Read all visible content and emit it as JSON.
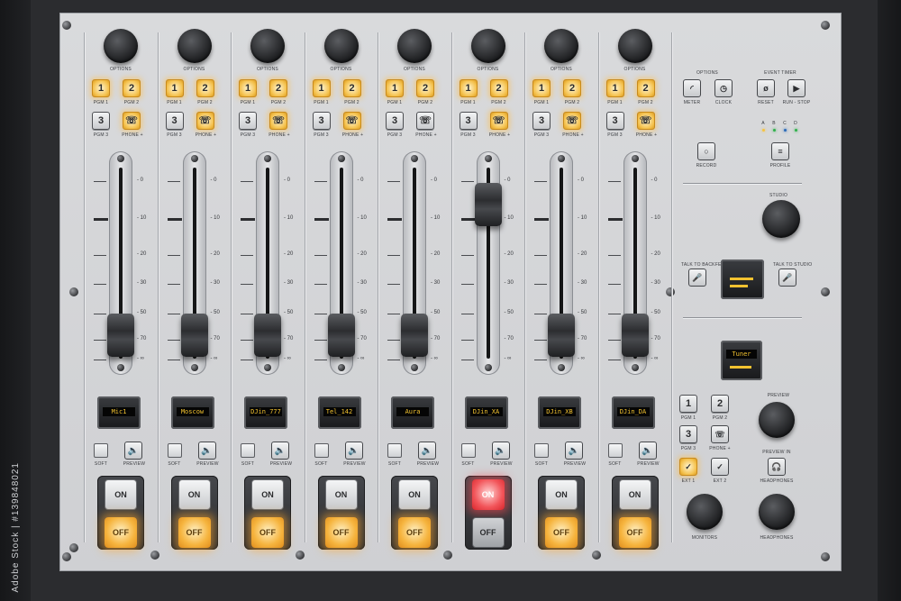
{
  "channels": [
    {
      "knob_label": "OPTIONS",
      "pgm1": "1",
      "pgm2": "2",
      "pgm3": "3",
      "pgm1_label": "PGM 1",
      "pgm2_label": "PGM 2",
      "pgm3_label": "PGM 3",
      "phone_label": "PHONE +",
      "display": "Mic1",
      "soft_label": "SOFT",
      "preview_label": "PREVIEW",
      "on_label": "ON",
      "off_label": "OFF",
      "fader_level": 0.12
    },
    {
      "knob_label": "OPTIONS",
      "pgm1": "1",
      "pgm2": "2",
      "pgm3": "3",
      "pgm1_label": "PGM 1",
      "pgm2_label": "PGM 2",
      "pgm3_label": "PGM 3",
      "phone_label": "PHONE +",
      "display": "Moscow",
      "soft_label": "SOFT",
      "preview_label": "PREVIEW",
      "on_label": "ON",
      "off_label": "OFF",
      "fader_level": 0.12
    },
    {
      "knob_label": "OPTIONS",
      "pgm1": "1",
      "pgm2": "2",
      "pgm3": "3",
      "pgm1_label": "PGM 1",
      "pgm2_label": "PGM 2",
      "pgm3_label": "PGM 3",
      "phone_label": "PHONE +",
      "display": "DJin_777",
      "soft_label": "SOFT",
      "preview_label": "PREVIEW",
      "on_label": "ON",
      "off_label": "OFF",
      "fader_level": 0.12
    },
    {
      "knob_label": "OPTIONS",
      "pgm1": "1",
      "pgm2": "2",
      "pgm3": "3",
      "pgm1_label": "PGM 1",
      "pgm2_label": "PGM 2",
      "pgm3_label": "PGM 3",
      "phone_label": "PHONE +",
      "display": "Tel_142",
      "soft_label": "SOFT",
      "preview_label": "PREVIEW",
      "on_label": "ON",
      "off_label": "OFF",
      "fader_level": 0.12
    },
    {
      "knob_label": "OPTIONS",
      "pgm1": "1",
      "pgm2": "2",
      "pgm3": "3",
      "pgm1_label": "PGM 1",
      "pgm2_label": "PGM 2",
      "pgm3_label": "PGM 3",
      "phone_label": "PHONE +",
      "display": "Aura",
      "soft_label": "SOFT",
      "preview_label": "PREVIEW",
      "on_label": "ON",
      "off_label": "OFF",
      "fader_level": 0.12
    },
    {
      "knob_label": "OPTIONS",
      "pgm1": "1",
      "pgm2": "2",
      "pgm3": "3",
      "pgm1_label": "PGM 1",
      "pgm2_label": "PGM 2",
      "pgm3_label": "PGM 3",
      "phone_label": "PHONE +",
      "display": "DJin_XA",
      "soft_label": "SOFT",
      "preview_label": "PREVIEW",
      "on_label": "ON",
      "off_label": "OFF",
      "fader_level": 0.86
    },
    {
      "knob_label": "OPTIONS",
      "pgm1": "1",
      "pgm2": "2",
      "pgm3": "3",
      "pgm1_label": "PGM 1",
      "pgm2_label": "PGM 2",
      "pgm3_label": "PGM 3",
      "phone_label": "PHONE +",
      "display": "DJin_XB",
      "soft_label": "SOFT",
      "preview_label": "PREVIEW",
      "on_label": "ON",
      "off_label": "OFF",
      "fader_level": 0.12
    },
    {
      "knob_label": "OPTIONS",
      "pgm1": "1",
      "pgm2": "2",
      "pgm3": "3",
      "pgm1_label": "PGM 1",
      "pgm2_label": "PGM 2",
      "pgm3_label": "PGM 3",
      "phone_label": "PHONE +",
      "display": "DJin_DA",
      "soft_label": "SOFT",
      "preview_label": "PREVIEW",
      "on_label": "ON",
      "off_label": "OFF",
      "fader_level": 0.12
    }
  ],
  "fader_scale": [
    "- 0",
    "- 10",
    "- 20",
    "- 30",
    "- 50",
    "- 70",
    "- ∞"
  ],
  "master": {
    "options_title": "OPTIONS",
    "event_timer_title": "EVENT TIMER",
    "meter_label": "METER",
    "clock_label": "CLOCK",
    "reset_label": "RESET",
    "run_stop_label": "RUN - STOP",
    "leds": [
      "A",
      "B",
      "C",
      "D"
    ],
    "record_label": "RECORD",
    "profile_label": "PROFILE",
    "studio_label": "STUDIO",
    "talk_backfeeds_label": "TALK TO BACKFEEDS",
    "talk_studio_label": "TALK TO STUDIO",
    "tuner_display": "Tuner",
    "pgm1": "1",
    "pgm2": "2",
    "pgm3": "3",
    "pgm1_label": "PGM 1",
    "pgm2_label": "PGM 2",
    "pgm3_label": "PGM 3",
    "phone_label": "PHONE +",
    "ext1_label": "EXT 1",
    "ext2_label": "EXT 2",
    "preview_title": "PREVIEW",
    "preview_in_label": "PREVIEW IN",
    "headphones_btn_label": "HEADPHONES",
    "monitors_label": "MONITORS",
    "headphones_label": "HEADPHONES"
  },
  "watermark": "Adobe Stock | #139848021",
  "colors": {
    "amber": "#f4c04a",
    "red": "#f2555a",
    "oled_text": "#f2c230"
  }
}
